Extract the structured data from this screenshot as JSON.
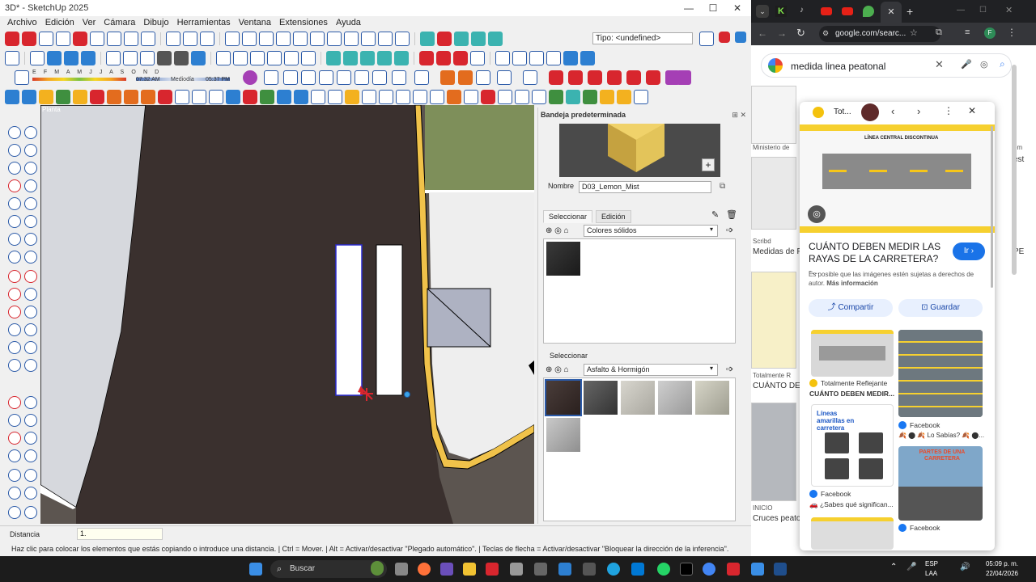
{
  "sketchup": {
    "title": "3D* - SketchUp 2025",
    "window_buttons": [
      "—",
      "☐",
      "✕"
    ],
    "menu": [
      "Archivo",
      "Edición",
      "Ver",
      "Cámara",
      "Dibujo",
      "Herramientas",
      "Ventana",
      "Extensiones",
      "Ayuda"
    ],
    "tipo_label": "Tipo: <undefined>",
    "shadow": {
      "months": "E F M A M J J A S O N D",
      "time_start": "07:32 AM",
      "time_mid": "Mediodía",
      "time_end": "05:37 PM"
    },
    "scene_label": "Planta",
    "tray": {
      "title": "Bandeja predeterminada",
      "name_label": "Nombre",
      "material_name": "D03_Lemon_Mist",
      "tab_select": "Seleccionar",
      "tab_edit": "Edición",
      "library1": "Colores sólidos",
      "select_label": "Seleccionar",
      "library2": "Asfalto & Hormigón"
    },
    "distance_label": "Distancia",
    "distance_value": "1.",
    "status": "Haz clic para colocar los elementos que estás copiando o introduce una distancia. | Ctrl = Mover. | Alt = Activar/desactivar \"Plegado automático\". | Teclas de flecha = Activar/desactivar \"Bloquear la dirección de la inferencia\"."
  },
  "chrome": {
    "url": "google.com/searc...",
    "search_query": "medida linea peatonal",
    "panel": {
      "source_short": "Tot...",
      "image_title": "LÍNEA CENTRAL DISCONTINUA",
      "title": "CUÁNTO DEBEN MEDIR LAS RAYAS DE LA CARRETERA? -...",
      "go_label": "Ir",
      "disclaimer": "Es posible que las imágenes estén sujetas a derechos de autor.",
      "more_info": "Más información",
      "share_label": "Compartir",
      "save_label": "Guardar",
      "results": [
        {
          "source": "Totalmente Reflejante",
          "caption": "CUÁNTO DEBEN MEDIR..."
        },
        {
          "source": "Facebook",
          "caption": "🍂 ⬤ 🍂 Lo Sabías? 🍂 ⬤..."
        },
        {
          "source": "Facebook",
          "caption": "🚗 ¿Sabes qué significan..."
        },
        {
          "source": "Facebook",
          "caption": ""
        }
      ],
      "thumb3_title": "Líneas amarillas en carretera",
      "thumb4_title": "PARTES DE UNA CARRETERA"
    },
    "background": {
      "left_items": [
        "Ministerio de",
        "Scribd",
        "Medidas de P",
        "Totalmente R",
        "CUÁNTO DEB",
        "INICIO",
        "Cruces peaton"
      ],
      "right_items": [
        "om",
        "est",
        "PE"
      ]
    }
  },
  "taskbar": {
    "search_label": "Buscar",
    "lang": "ESP",
    "lang2": "LAA",
    "time": "05:09 p. m.",
    "date": "22/04/2026"
  }
}
